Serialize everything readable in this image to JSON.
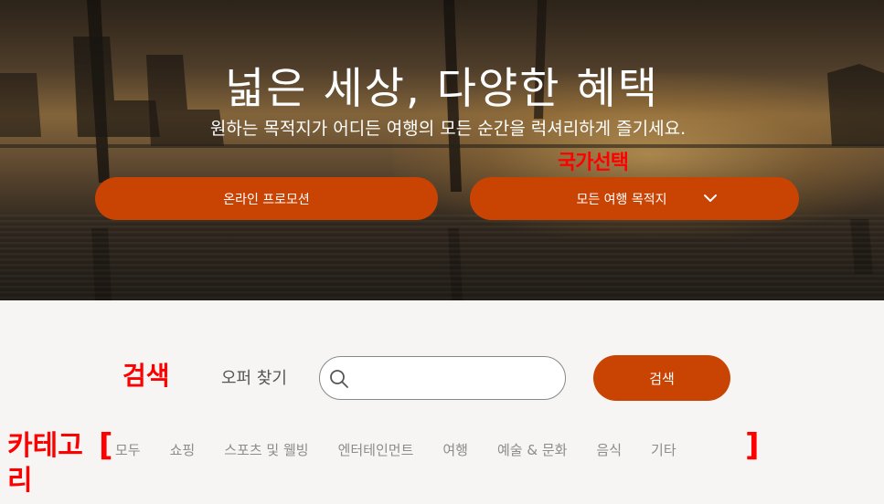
{
  "hero": {
    "title": "넓은 세상, 다양한 혜택",
    "subtitle": "원하는 목적지가 어디든 여행의 모든 순간을 럭셔리하게 즐기세요.",
    "promo_button_label": "온라인 프로모션",
    "destination_button_label": "모든 여행 목적지"
  },
  "annotations": {
    "country_select": "국가선택",
    "search": "검색",
    "category": "카테고리"
  },
  "search": {
    "offer_label": "오퍼 찾기",
    "input_value": "",
    "button_label": "검색"
  },
  "categories": [
    "모두",
    "쇼핑",
    "스포츠 및 웰빙",
    "엔터테인먼트",
    "여행",
    "예술 & 문화",
    "음식",
    "기타"
  ],
  "colors": {
    "accent": "#c94303",
    "page_background": "#f7f5f3",
    "annotation": "#ff0000",
    "category_text": "#8c8c8c"
  },
  "icons": {
    "search": "search-icon",
    "dropdown": "chevron-down-icon"
  }
}
